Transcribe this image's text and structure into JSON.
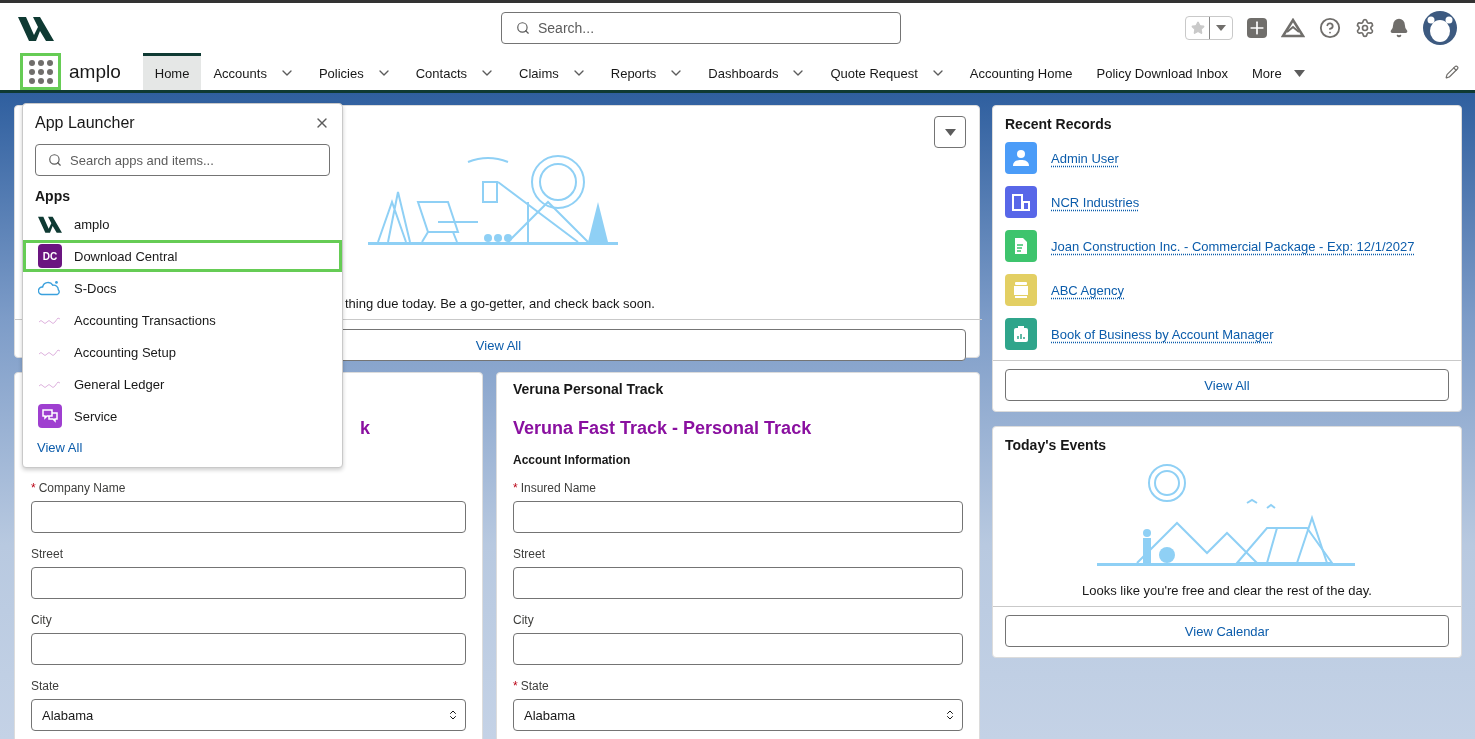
{
  "header": {
    "search_placeholder": "Search...",
    "app_name": "amplo"
  },
  "launcher_button": {
    "highlighted": true
  },
  "nav_tabs": [
    {
      "label": "Home",
      "selected": true,
      "has_menu": false
    },
    {
      "label": "Accounts",
      "selected": false,
      "has_menu": true
    },
    {
      "label": "Policies",
      "selected": false,
      "has_menu": true
    },
    {
      "label": "Contacts",
      "selected": false,
      "has_menu": true
    },
    {
      "label": "Claims",
      "selected": false,
      "has_menu": true
    },
    {
      "label": "Reports",
      "selected": false,
      "has_menu": true
    },
    {
      "label": "Dashboards",
      "selected": false,
      "has_menu": true
    },
    {
      "label": "Quote Request",
      "selected": false,
      "has_menu": true
    },
    {
      "label": "Accounting Home",
      "selected": false,
      "has_menu": false
    },
    {
      "label": "Policy Download Inbox",
      "selected": false,
      "has_menu": false
    }
  ],
  "nav_more": "More",
  "tasks_card": {
    "message": "thing due today. Be a go-getter, and check back soon.",
    "button": "View All"
  },
  "quote_cards": [
    {
      "heading": "k",
      "fields": [
        {
          "label": "Company Name",
          "marker": "*",
          "kind": "text"
        },
        {
          "label": "Street",
          "kind": "text"
        },
        {
          "label": "City",
          "kind": "text"
        },
        {
          "label": "State",
          "kind": "select",
          "value": "Alabama"
        }
      ]
    },
    {
      "title": "Veruna Personal Track",
      "heading": "Veruna Fast Track - Personal Track",
      "section": "Account Information",
      "fields": [
        {
          "label": "Insured Name",
          "marker": "*",
          "kind": "text"
        },
        {
          "label": "Street",
          "kind": "text"
        },
        {
          "label": "City",
          "kind": "text"
        },
        {
          "label": "State",
          "marker": "*",
          "kind": "select",
          "value": "Alabama"
        }
      ]
    }
  ],
  "recent_records": {
    "title": "Recent Records",
    "items": [
      {
        "label": "Admin User",
        "kind": "person",
        "color": "#4b9cf8"
      },
      {
        "label": "NCR Industries",
        "kind": "building",
        "color": "#5867e8"
      },
      {
        "label": "Joan Construction Inc. - Commercial Package - Exp: 12/1/2027",
        "kind": "document",
        "color": "#3ec46d"
      },
      {
        "label": "ABC Agency",
        "kind": "container",
        "color": "#e3cf63"
      },
      {
        "label": "Book of Business by Account Manager",
        "kind": "report",
        "color": "#2fa58b"
      }
    ],
    "button": "View All"
  },
  "events": {
    "title": "Today's Events",
    "message": "Looks like you're free and clear the rest of the day.",
    "button": "View Calendar"
  },
  "app_launcher": {
    "title": "App Launcher",
    "search_placeholder": "Search apps and items...",
    "section": "Apps",
    "view_all": "View All",
    "apps": [
      {
        "label": "amplo",
        "kind": "logo",
        "highlighted": false
      },
      {
        "label": "Download Central",
        "kind": "badge",
        "badge": "DC",
        "highlighted": true
      },
      {
        "label": "S-Docs",
        "kind": "cloud",
        "highlighted": false
      },
      {
        "label": "Accounting Transactions",
        "kind": "script",
        "highlighted": false
      },
      {
        "label": "Accounting Setup",
        "kind": "script",
        "highlighted": false
      },
      {
        "label": "General Ledger",
        "kind": "script",
        "highlighted": false
      },
      {
        "label": "Service",
        "kind": "chat",
        "highlighted": false
      }
    ]
  }
}
